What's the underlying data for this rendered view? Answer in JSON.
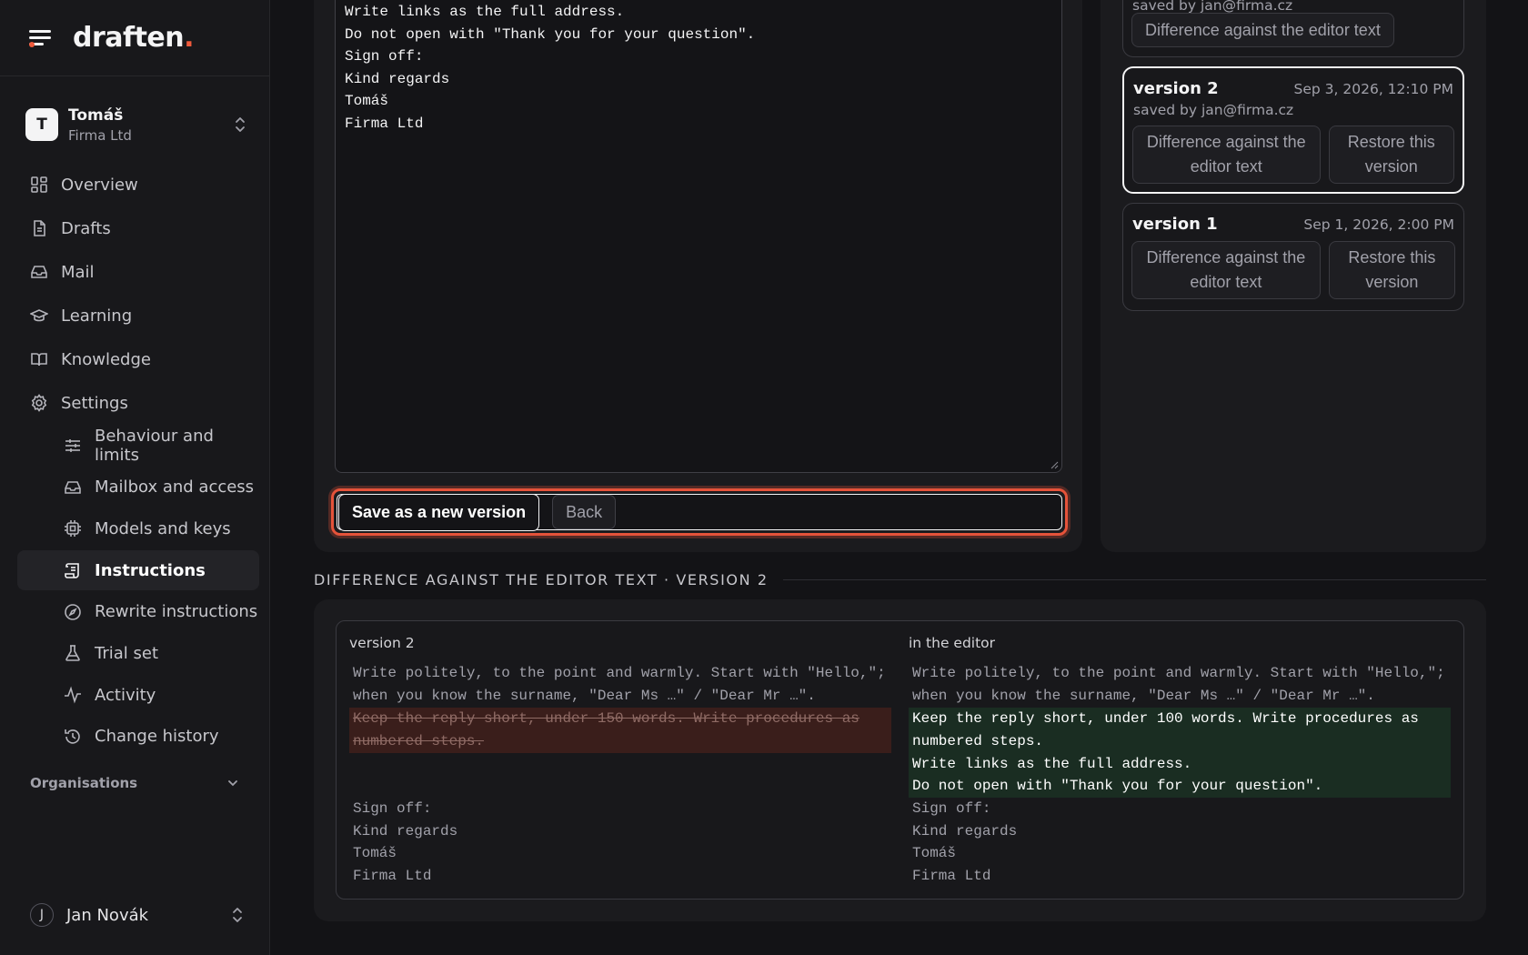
{
  "app": {
    "brand": "draften",
    "brand_dot": "."
  },
  "org": {
    "initial": "T",
    "name": "Tomáš",
    "company": "Firma Ltd"
  },
  "nav": {
    "overview": "Overview",
    "drafts": "Drafts",
    "mail": "Mail",
    "learning": "Learning",
    "knowledge": "Knowledge",
    "settings": "Settings",
    "settings_items": [
      {
        "label": "Behaviour and limits",
        "icon": "sliders-icon"
      },
      {
        "label": "Mailbox and access",
        "icon": "inbox-icon"
      },
      {
        "label": "Models and keys",
        "icon": "chip-icon"
      },
      {
        "label": "Instructions",
        "icon": "scroll-icon",
        "active": true
      },
      {
        "label": "Rewrite instructions",
        "icon": "compass-icon"
      },
      {
        "label": "Trial set",
        "icon": "flask-icon"
      },
      {
        "label": "Activity",
        "icon": "activity-icon"
      },
      {
        "label": "Change history",
        "icon": "history-icon"
      }
    ],
    "organisations": "Organisations"
  },
  "user": {
    "initial": "J",
    "name": "Jan Novák"
  },
  "editor": {
    "lines": [
      "Write links as the full address.",
      "Do not open with \"Thank you for your question\".",
      "Sign off:",
      "Kind regards",
      "Tomáš",
      "Firma Ltd"
    ],
    "save_label": "Save as a new version",
    "back_label": "Back"
  },
  "versions": {
    "top_partial": {
      "by": "saved by jan@firma.cz",
      "diff_label": "Difference against the editor text"
    },
    "items": [
      {
        "title": "version 2",
        "date": "Sep 3, 2026, 12:10 PM",
        "by": "saved by jan@firma.cz",
        "diff_label": "Difference against the editor text",
        "restore_label": "Restore this version",
        "selected": true
      },
      {
        "title": "version 1",
        "date": "Sep 1, 2026, 2:00 PM",
        "diff_label": "Difference against the editor text",
        "restore_label": "Restore this version",
        "selected": false
      }
    ]
  },
  "diff": {
    "title": "DIFFERENCE AGAINST THE EDITOR TEXT · VERSION 2",
    "left_title": "version 2",
    "right_title": "in the editor",
    "left_lines": [
      {
        "text": "Write politely, to the point and warmly. Start with \"Hello,\";",
        "type": "same"
      },
      {
        "text": "when you know the surname, \"Dear Ms …\" / \"Dear Mr …\".",
        "type": "same"
      },
      {
        "text": "Keep the reply short, under 150 words. Write procedures as",
        "type": "del"
      },
      {
        "text": "numbered steps.",
        "type": "del"
      },
      {
        "text": "Sign off:",
        "type": "same"
      },
      {
        "text": "Kind regards",
        "type": "same"
      },
      {
        "text": "Tomáš",
        "type": "same"
      },
      {
        "text": "Firma Ltd",
        "type": "same"
      }
    ],
    "right_lines": [
      {
        "text": "Write politely, to the point and warmly. Start with \"Hello,\";",
        "type": "same"
      },
      {
        "text": "when you know the surname, \"Dear Ms …\" / \"Dear Mr …\".",
        "type": "same"
      },
      {
        "text": "Keep the reply short, under 100 words. Write procedures as",
        "type": "add"
      },
      {
        "text": "numbered steps.",
        "type": "add"
      },
      {
        "text": "Write links as the full address.",
        "type": "add"
      },
      {
        "text": "Do not open with \"Thank you for your question\".",
        "type": "add"
      },
      {
        "text": "Sign off:",
        "type": "same"
      },
      {
        "text": "Kind regards",
        "type": "same"
      },
      {
        "text": "Tomáš",
        "type": "same"
      },
      {
        "text": "Firma Ltd",
        "type": "same"
      }
    ]
  },
  "colors": {
    "accent": "#ef5a3c",
    "deleted_bg": "#3a1e1b",
    "added_bg": "#1a2d22"
  }
}
